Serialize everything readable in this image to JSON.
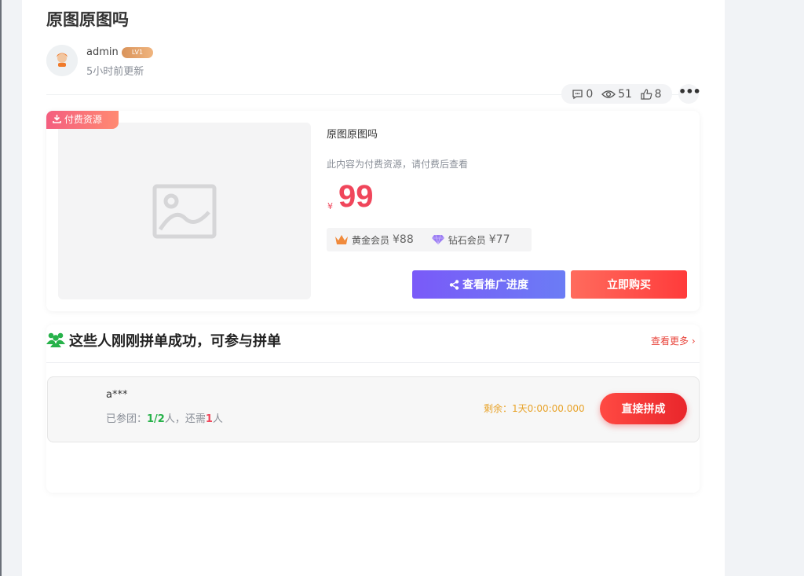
{
  "post": {
    "title": "原图原图吗",
    "author": "admin",
    "level_badge": "LV1",
    "updated": "5小时前更新",
    "stats": {
      "comments": "0",
      "views": "51",
      "likes": "8"
    },
    "more_label": "•••"
  },
  "resource": {
    "tag": "付费资源",
    "title": "原图原图吗",
    "description": "此内容为付费资源，请付费后查看",
    "currency": "¥",
    "price": "99",
    "vip": [
      {
        "name": "黄金会员",
        "price": "¥88",
        "icon": "crown-icon",
        "color": "#f08a3c"
      },
      {
        "name": "钻石会员",
        "price": "¥77",
        "icon": "diamond-icon",
        "color": "#9b7cf3"
      }
    ],
    "share_button": "查看推广进度",
    "buy_button": "立即购买"
  },
  "group": {
    "title": "这些人刚刚拼单成功，可参与拼单",
    "more_link": "查看更多",
    "rows": [
      {
        "user": "a***",
        "joined_prefix": "已参团：",
        "joined_count": "1/2",
        "joined_mid": "人，还需",
        "needed": "1",
        "joined_suffix": "人",
        "remaining": "剩余：1天0:00:00.000",
        "join_button": "直接拼成"
      }
    ]
  },
  "colors": {
    "accent_red": "#f0465b",
    "share_purple": "#7a5af8",
    "group_green": "#27b24a",
    "timer_orange": "#e8a32a"
  }
}
